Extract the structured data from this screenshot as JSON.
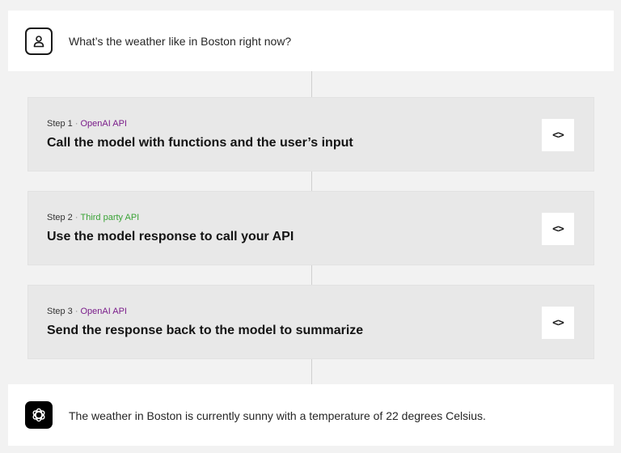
{
  "user_message": {
    "icon": "user-icon",
    "text": "What’s the weather like in Boston right now?"
  },
  "steps": [
    {
      "label": "Step 1",
      "source": "OpenAI API",
      "source_color": "#7a1d8a",
      "title": "Call the model with functions and the user’s input",
      "code_button": "<>"
    },
    {
      "label": "Step 2",
      "source": "Third party API",
      "source_color": "#3aa336",
      "title": "Use the model response to call your API",
      "code_button": "<>"
    },
    {
      "label": "Step 3",
      "source": "OpenAI API",
      "source_color": "#7a1d8a",
      "title": "Send the response back to the model to summarize",
      "code_button": "<>"
    }
  ],
  "assistant_message": {
    "icon": "openai-logo-icon",
    "text": "The weather in Boston is currently sunny with a temperature of 22 degrees Celsius."
  },
  "separator": "·"
}
